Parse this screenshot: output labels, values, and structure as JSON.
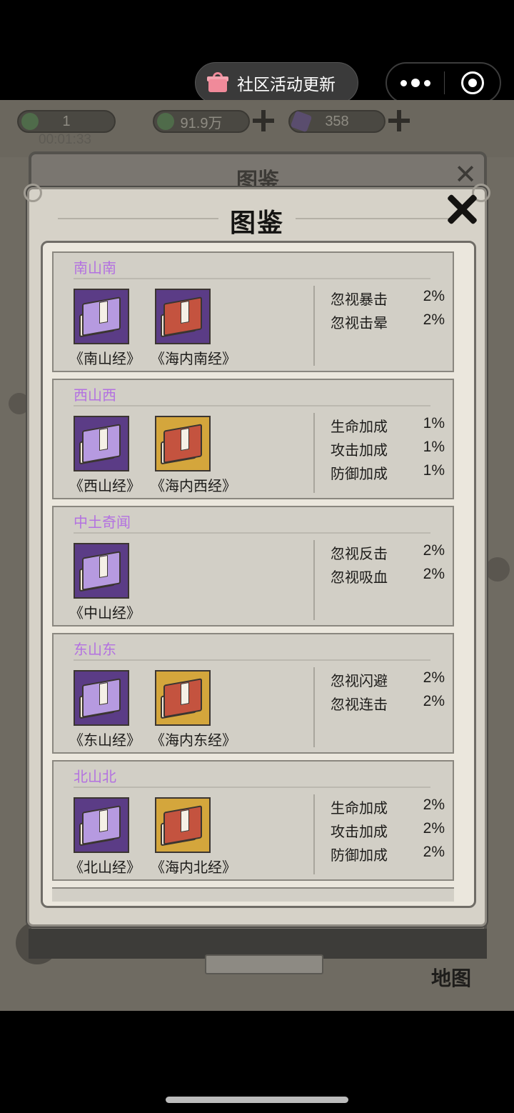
{
  "top_bar": {
    "notice_label": "社区活动更新"
  },
  "game_hud": {
    "resource_1": "1",
    "resource_2": "91.9万",
    "resource_3": "358",
    "timer": "00:01:33",
    "map_label": "地图",
    "background_panel_title": "图鉴"
  },
  "modal": {
    "title": "图鉴",
    "cards": [
      {
        "title": "南山南",
        "books": [
          {
            "name": "《南山经》",
            "frame": "purple",
            "cover": "lavender"
          },
          {
            "name": "《海内南经》",
            "frame": "purple",
            "cover": "red"
          }
        ],
        "stats": [
          {
            "label": "忽视暴击",
            "value": "2%"
          },
          {
            "label": "忽视击晕",
            "value": "2%"
          }
        ]
      },
      {
        "title": "西山西",
        "books": [
          {
            "name": "《西山经》",
            "frame": "purple",
            "cover": "lavender"
          },
          {
            "name": "《海内西经》",
            "frame": "gold",
            "cover": "red"
          }
        ],
        "stats": [
          {
            "label": "生命加成",
            "value": "1%"
          },
          {
            "label": "攻击加成",
            "value": "1%"
          },
          {
            "label": "防御加成",
            "value": "1%"
          }
        ]
      },
      {
        "title": "中土奇闻",
        "books": [
          {
            "name": "《中山经》",
            "frame": "purple",
            "cover": "lavender"
          }
        ],
        "stats": [
          {
            "label": "忽视反击",
            "value": "2%"
          },
          {
            "label": "忽视吸血",
            "value": "2%"
          }
        ]
      },
      {
        "title": "东山东",
        "books": [
          {
            "name": "《东山经》",
            "frame": "purple",
            "cover": "lavender"
          },
          {
            "name": "《海内东经》",
            "frame": "gold",
            "cover": "red"
          }
        ],
        "stats": [
          {
            "label": "忽视闪避",
            "value": "2%"
          },
          {
            "label": "忽视连击",
            "value": "2%"
          }
        ]
      },
      {
        "title": "北山北",
        "books": [
          {
            "name": "《北山经》",
            "frame": "purple",
            "cover": "lavender"
          },
          {
            "name": "《海内北经》",
            "frame": "gold",
            "cover": "red"
          }
        ],
        "stats": [
          {
            "label": "生命加成",
            "value": "2%"
          },
          {
            "label": "攻击加成",
            "value": "2%"
          },
          {
            "label": "防御加成",
            "value": "2%"
          }
        ]
      }
    ]
  },
  "colors": {
    "card_title": "#b371e0",
    "book_frame_purple": "#5b3c86",
    "book_frame_gold": "#d4a63c",
    "modal_bg": "#d6d2c8"
  },
  "icons": [
    "gift-icon",
    "more-dots-icon",
    "target-icon",
    "close-x-icon",
    "plus-icon"
  ]
}
